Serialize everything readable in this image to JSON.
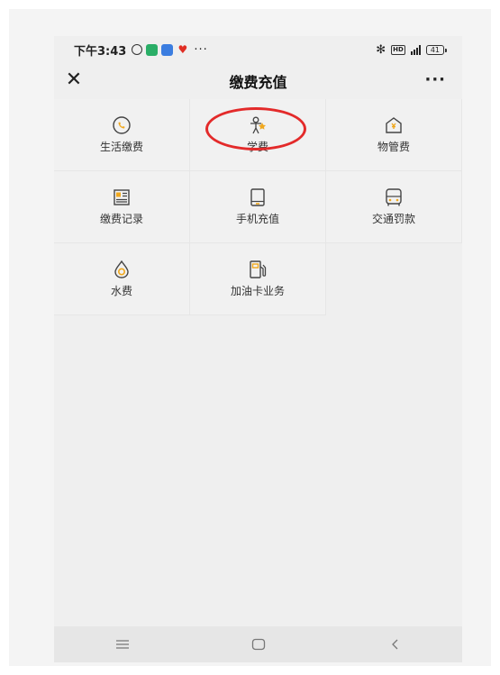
{
  "statusbar": {
    "time": "下午3:43",
    "dots": "···",
    "hd": "HD",
    "battery": "41"
  },
  "header": {
    "title": "缴费充值",
    "close_icon": "close-icon",
    "more_icon": "more-icon",
    "more": "···"
  },
  "services": [
    {
      "label": "生活缴费",
      "icon": "phone-circle-icon"
    },
    {
      "label": "学费",
      "icon": "student-icon"
    },
    {
      "label": "物管费",
      "icon": "house-yuan-icon"
    },
    {
      "label": "缴费记录",
      "icon": "receipt-icon"
    },
    {
      "label": "手机充值",
      "icon": "mobile-phone-icon"
    },
    {
      "label": "交通罚款",
      "icon": "bus-icon"
    },
    {
      "label": "水费",
      "icon": "water-drop-icon"
    },
    {
      "label": "加油卡业务",
      "icon": "fuel-pump-icon"
    }
  ],
  "colors": {
    "accent": "#f0a81e",
    "highlight": "#e32a2a"
  },
  "navbar": {
    "menu_icon": "menu-icon",
    "home_icon": "home-icon",
    "back_icon": "back-icon"
  }
}
